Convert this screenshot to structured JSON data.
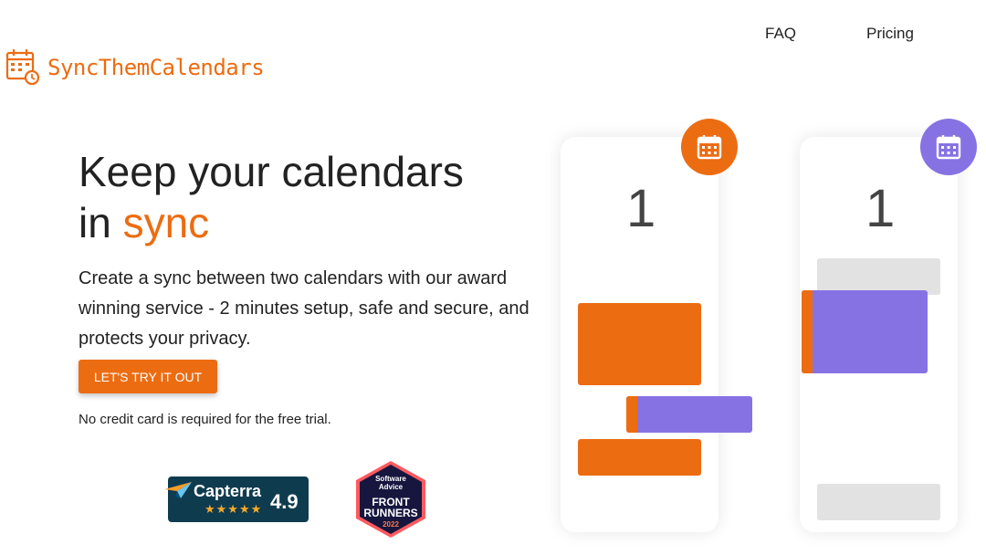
{
  "brand": {
    "name": "SyncThemCalendars",
    "accent_color": "#EC6C12",
    "secondary_color": "#8772E3",
    "logo_icon": "calendar-clock-icon"
  },
  "nav": {
    "items": [
      {
        "label": "FAQ"
      },
      {
        "label": "Pricing"
      }
    ]
  },
  "hero": {
    "title_line1": "Keep your calendars",
    "title_line2_prefix": "in ",
    "title_line2_accent": "sync",
    "description": "Create a sync between two calendars with our award winning service - 2 minutes setup, safe and secure, and protects your privacy.",
    "cta_label": "LET'S TRY IT OUT",
    "cta_note": "No credit card is required for the free trial."
  },
  "badges": {
    "capterra": {
      "name": "Capterra",
      "stars": "★★★★★",
      "score": "4.9"
    },
    "software_advice": {
      "brand_line1": "Software",
      "brand_line2": "Advice",
      "line1": "FRONT",
      "line2": "RUNNERS",
      "year": "2022"
    }
  },
  "illustration": {
    "left_calendar": {
      "day": "1",
      "icon": "calendar-icon",
      "color": "#EC6C12"
    },
    "right_calendar": {
      "day": "1",
      "icon": "calendar-icon",
      "color": "#8772E3"
    }
  }
}
